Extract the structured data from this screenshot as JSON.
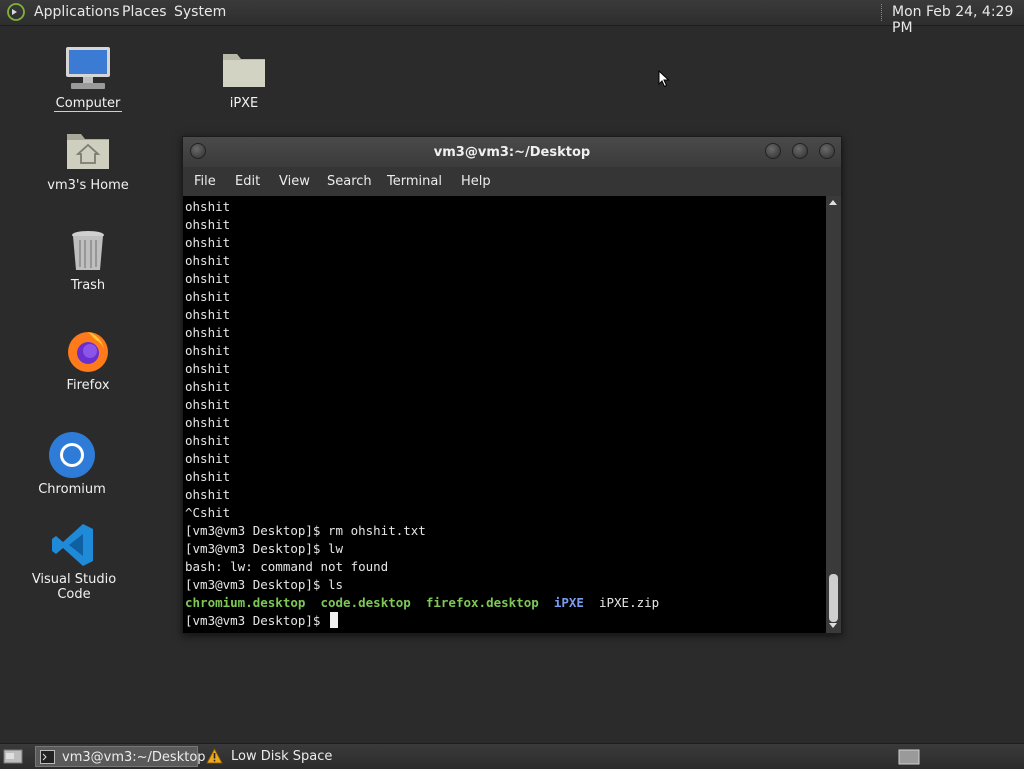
{
  "top_panel": {
    "menus": [
      "Applications",
      "Places",
      "System"
    ],
    "clock": "Mon Feb 24,  4:29 PM"
  },
  "desktop_icons": [
    {
      "label": "Computer",
      "icon": "computer-icon"
    },
    {
      "label": "iPXE",
      "icon": "folder-icon"
    },
    {
      "label": "vm3's Home",
      "icon": "home-folder-icon"
    },
    {
      "label": "Trash",
      "icon": "trash-icon"
    },
    {
      "label": "Firefox",
      "icon": "firefox-icon"
    },
    {
      "label": "Chromium",
      "icon": "chromium-icon"
    },
    {
      "label": "Visual Studio Code",
      "icon": "vscode-icon"
    }
  ],
  "terminal": {
    "title": "vm3@vm3:~/Desktop",
    "menu": [
      "File",
      "Edit",
      "View",
      "Search",
      "Terminal",
      "Help"
    ],
    "lines": [
      "ohshit",
      "ohshit",
      "ohshit",
      "ohshit",
      "ohshit",
      "ohshit",
      "ohshit",
      "ohshit",
      "ohshit",
      "ohshit",
      "ohshit",
      "ohshit",
      "ohshit",
      "ohshit",
      "ohshit",
      "ohshit",
      "ohshit",
      "^Cshit",
      "[vm3@vm3 Desktop]$ rm ohshit.txt",
      "[vm3@vm3 Desktop]$ lw",
      "bash: lw: command not found",
      "[vm3@vm3 Desktop]$ ls"
    ],
    "ls_output": [
      {
        "text": "chromium.desktop",
        "style": "g"
      },
      {
        "text": "code.desktop",
        "style": "g"
      },
      {
        "text": "firefox.desktop",
        "style": "g"
      },
      {
        "text": "iPXE",
        "style": "b"
      },
      {
        "text": "iPXE.zip",
        "style": ""
      }
    ],
    "prompt": "[vm3@vm3 Desktop]$ "
  },
  "taskbar": {
    "items": [
      {
        "label": "vm3@vm3:~/Desktop",
        "icon": "terminal-icon",
        "active": true
      },
      {
        "label": "Low Disk Space",
        "icon": "warning-icon",
        "active": false
      }
    ]
  },
  "colors": {
    "desktop_bg": "#2b2b2b",
    "ls_executable": "#7ec855",
    "ls_directory": "#7a9cf0"
  }
}
